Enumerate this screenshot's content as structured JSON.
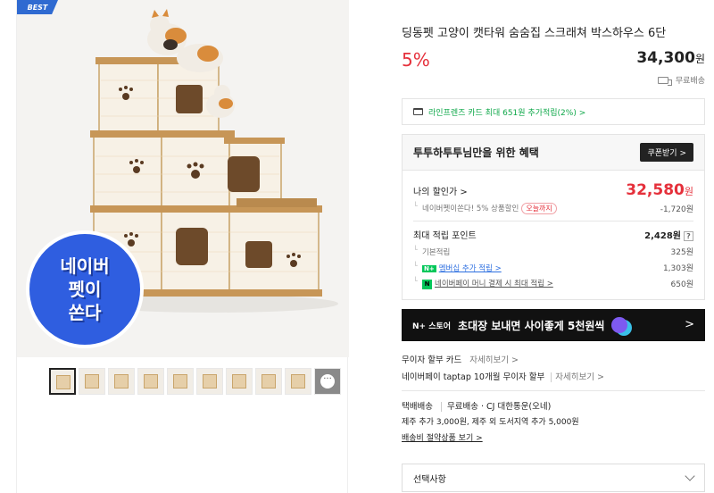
{
  "product": {
    "badge": "BEST",
    "title": "딩동펫 고양이 캣타워 숨숨집 스크래쳐 박스하우스 6단",
    "discount": "5%",
    "price": "34,300",
    "price_unit": "원",
    "shipping": "무료배송"
  },
  "promo_sticker": [
    "네이버",
    "펫이",
    "쏜다"
  ],
  "card_benefit": "라인프렌즈 카드 최대 651원 추가적립(2%) >",
  "benefit": {
    "header": "투투하투투님만을 위한 혜택",
    "coupon_button": "쿠폰받기 >",
    "my_discount_label": "나의 할인가 >",
    "my_discount_value": "32,580",
    "my_discount_unit": "원",
    "naver_pet_label": "네이버펫이쏜다! 5% 상품할인",
    "today_only": "오늘까지",
    "naver_pet_value": "-1,720원",
    "points_label": "최대 적립 포인트",
    "points_value": "2,428원",
    "points_help": "?",
    "basic_label": "기본적립",
    "basic_value": "325원",
    "member_label": "멤버십 추가 적립 >",
    "member_value": "1,303원",
    "npay_label": "네이버페이 머니 결제 시 최대 적립 >",
    "npay_value": "650원"
  },
  "banner": {
    "store": "N+ 스토어",
    "text": "초대장 보내면 사이좋게 5천원씩",
    "chevron": ">"
  },
  "installment": {
    "line1_label": "무이자 할부 카드",
    "line1_link": "자세히보기 >",
    "line2_label": "네이버페이 taptap 10개월 무이자 할부",
    "line2_link": "자세히보기 >"
  },
  "delivery": {
    "type": "택배배송",
    "detail": "무료배송 · CJ 대한통운(오네)",
    "extra": "제주 추가 3,000원, 제주 외 도서지역 추가 5,000원",
    "link": "배송비 절약상품 보기 >"
  },
  "option_select": "선택사항",
  "thumbnails": 10,
  "thumb_more": "···",
  "colors": {
    "accent_red": "#e5303b",
    "naver_green": "#03c75a",
    "link_blue": "#2d6fe0",
    "badge_blue": "#2f6ad1"
  }
}
